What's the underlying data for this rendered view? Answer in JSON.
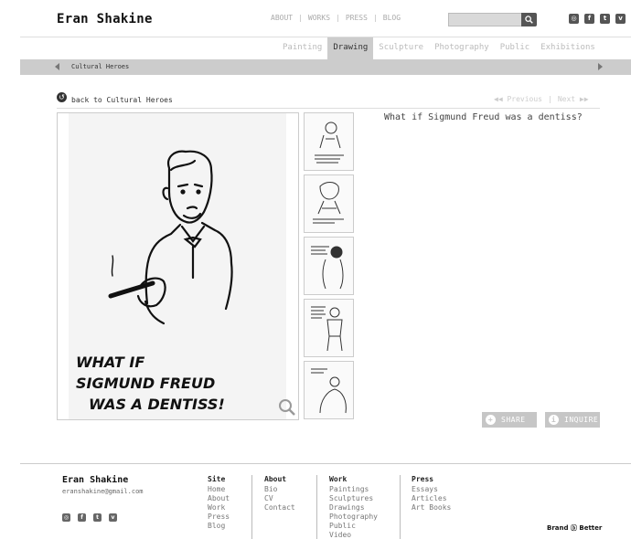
{
  "header": {
    "site_title": "Eran Shakine",
    "nav": [
      "ABOUT",
      "WORKS",
      "PRESS",
      "BLOG"
    ],
    "search": {
      "placeholder": "",
      "icon": "search-icon"
    },
    "socials": [
      {
        "name": "instagram-icon",
        "glyph": "◎"
      },
      {
        "name": "facebook-icon",
        "glyph": "f"
      },
      {
        "name": "tumblr-icon",
        "glyph": "t"
      },
      {
        "name": "vimeo-icon",
        "glyph": "v"
      }
    ]
  },
  "category_tabs": [
    {
      "label": "Painting",
      "active": false
    },
    {
      "label": "Drawing",
      "active": true
    },
    {
      "label": "Sculpture",
      "active": false
    },
    {
      "label": "Photography",
      "active": false
    },
    {
      "label": "Public",
      "active": false
    },
    {
      "label": "Exhibitions",
      "active": false
    }
  ],
  "subbar": {
    "label": "Cultural Heroes"
  },
  "artwork_nav": {
    "back_label": "back to Cultural Heroes",
    "previous_label": "Previous",
    "next_label": "Next"
  },
  "artwork": {
    "title": "What if Sigmund Freud was a dentiss?",
    "caption_lines": [
      "WHAT IF",
      "SIGMUND FREUD",
      "WAS A DENTISS!"
    ]
  },
  "thumbnails": [
    {
      "name": "thumb-1"
    },
    {
      "name": "thumb-2"
    },
    {
      "name": "thumb-3"
    },
    {
      "name": "thumb-4"
    },
    {
      "name": "thumb-5"
    }
  ],
  "actions": {
    "share_label": "SHARE",
    "inquire_label": "INQUIRE"
  },
  "footer": {
    "name": "Eran Shakine",
    "email": "eranshakine@gmail.com",
    "columns": [
      {
        "title": "Site",
        "items": [
          "Home",
          "About",
          "Work",
          "Press",
          "Blog"
        ]
      },
      {
        "title": "About",
        "items": [
          "Bio",
          "CV",
          "Contact"
        ]
      },
      {
        "title": "Work",
        "items": [
          "Paintings",
          "Sculptures",
          "Drawings",
          "Photography",
          "Public",
          "Video"
        ]
      },
      {
        "title": "Press",
        "items": [
          "Essays",
          "Articles",
          "Art Books"
        ]
      }
    ],
    "brand": "Brand ⓑ Better"
  }
}
